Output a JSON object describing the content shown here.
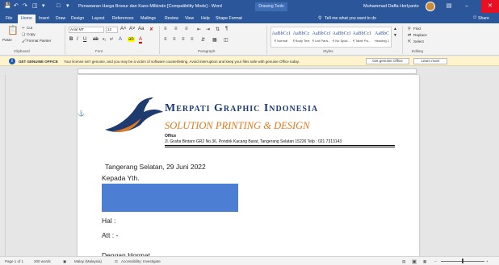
{
  "titlebar": {
    "doc_title": "Penawaran Harga Brosur dan Kaos Milkindo [Compatibility Mode] - Word",
    "tools_tab": "Drawing Tools",
    "user": "Muhammad Daffa Herlyanto"
  },
  "tabs": {
    "file": "File",
    "home": "Home",
    "insert": "Insert",
    "draw": "Draw",
    "design": "Design",
    "layout": "Layout",
    "references": "References",
    "mailings": "Mailings",
    "review": "Review",
    "view": "View",
    "help": "Help",
    "shape_format": "Shape Format",
    "tell_me": "Tell me what you want to do",
    "share": "Share"
  },
  "ribbon": {
    "clipboard": {
      "paste": "Paste",
      "cut": "Cut",
      "copy": "Copy",
      "format_painter": "Format Painter",
      "label": "Clipboard"
    },
    "font": {
      "name": "Arial MT",
      "size": "12",
      "label": "Font"
    },
    "paragraph": {
      "label": "Paragraph"
    },
    "styles": {
      "label": "Styles",
      "items": [
        {
          "preview": "AaBbCcI",
          "name": "¶ Normal"
        },
        {
          "preview": "AaBbCc",
          "name": "¶ Body Text"
        },
        {
          "preview": "AaBbCcI",
          "name": "¶ List Para..."
        },
        {
          "preview": "AaBbCcI",
          "name": "¶ No Spac..."
        },
        {
          "preview": "AaBbCcI",
          "name": "¶ Table Pa..."
        },
        {
          "preview": "AaBbC",
          "name": "Heading 1"
        }
      ]
    },
    "editing": {
      "find": "Find",
      "replace": "Replace",
      "select": "Select",
      "label": "Editing"
    }
  },
  "infobar": {
    "title": "GET GENUINE OFFICE",
    "message": "Your license isn't genuine, and you may be a victim of software counterfeiting. Avoid interruption and keep your files safe with genuine Office today.",
    "btn_genuine": "Get genuine Office",
    "btn_learn": "Learn more"
  },
  "letterhead": {
    "company": "Merpati Graphic Indonesia",
    "tagline": "SOLUTION PRINTING & DESIGN",
    "office_label": "Office",
    "address": "Jl. Graha Bintaro GR2 No.36, Pondok Kacang Barat, Tangerang Selatan 15226 Telp : 021 7313143"
  },
  "letter": {
    "date_line": "Tangerang Selatan, 29 Juni 2022",
    "to_line": "Kepada Yth.",
    "hal": "Hal :",
    "att": "Att   : -",
    "greeting": "Dengan Hormat,"
  },
  "statusbar": {
    "page": "Page 1 of 1",
    "words": "200 words",
    "language": "Malay (Malaysia)",
    "accessibility": "Accessibility: Investigate"
  },
  "colors": {
    "word_blue": "#2b579a",
    "brand_navy": "#1e3a6e",
    "brand_orange": "#e07a1e",
    "redaction": "#4c7fd3"
  }
}
